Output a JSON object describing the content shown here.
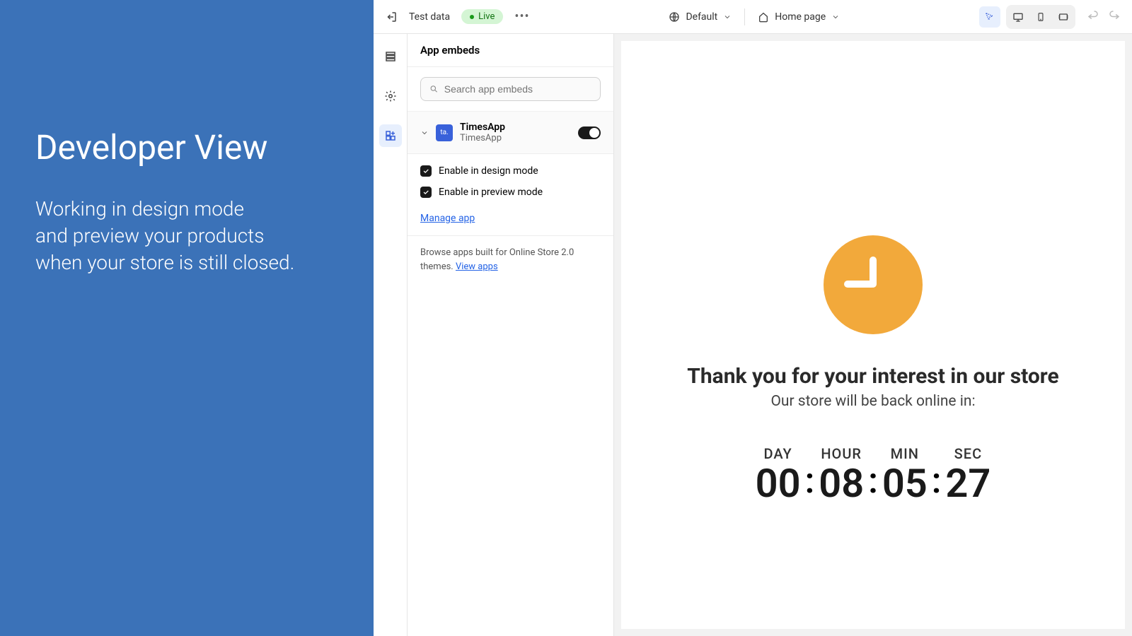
{
  "left": {
    "title": "Developer View",
    "subtitle_l1": "Working in design mode",
    "subtitle_l2": "and preview your products",
    "subtitle_l3": "when your store is still closed."
  },
  "topbar": {
    "data_label": "Test data",
    "live_badge": "Live",
    "default_dropdown": "Default",
    "home_dropdown": "Home page"
  },
  "sidebar": {
    "title": "App embeds",
    "search_placeholder": "Search app embeds",
    "app": {
      "icon_text": "ta.",
      "name": "TimesApp",
      "sub": "TimesApp"
    },
    "opt_design": "Enable in design mode",
    "opt_preview": "Enable in preview mode",
    "manage_link": "Manage app",
    "browse_prefix": "Browse apps built for Online Store 2.0 themes. ",
    "browse_link": "View apps"
  },
  "preview": {
    "title": "Thank you for your interest in our store",
    "sub": "Our store will be back online in:",
    "labels": {
      "day": "DAY",
      "hour": "HOUR",
      "min": "MIN",
      "sec": "SEC"
    },
    "values": {
      "day": "00",
      "hour": "08",
      "min": "05",
      "sec": "27"
    }
  }
}
